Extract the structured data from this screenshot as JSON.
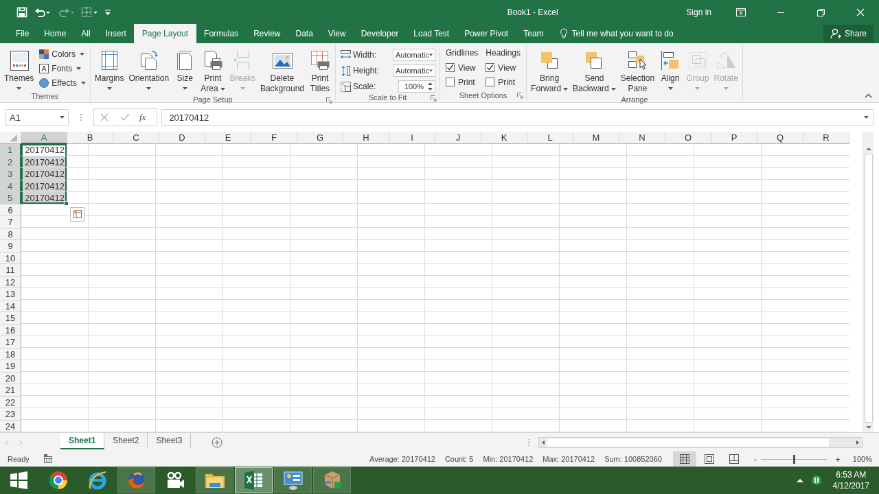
{
  "window": {
    "title": "Book1 - Excel",
    "sign_in": "Sign in"
  },
  "quick_access": [
    {
      "disabled": false
    },
    {
      "disabled": false
    },
    {
      "disabled": true
    },
    {
      "disabled": false
    },
    {
      "disabled": false
    }
  ],
  "tabs": [
    {
      "label": "File",
      "selected": false
    },
    {
      "label": "Home",
      "selected": false
    },
    {
      "label": "All",
      "selected": false
    },
    {
      "label": "Insert",
      "selected": false
    },
    {
      "label": "Page Layout",
      "selected": true
    },
    {
      "label": "Formulas",
      "selected": false
    },
    {
      "label": "Review",
      "selected": false
    },
    {
      "label": "Data",
      "selected": false
    },
    {
      "label": "View",
      "selected": false
    },
    {
      "label": "Developer",
      "selected": false
    },
    {
      "label": "Load Test",
      "selected": false
    },
    {
      "label": "Power Pivot",
      "selected": false
    },
    {
      "label": "Team",
      "selected": false
    }
  ],
  "tell_me": {
    "placeholder": "Tell me what you want to do"
  },
  "share": "Share",
  "ribbon": [
    {
      "label": "Themes",
      "launcher": false,
      "items": [
        {
          "kind": "large",
          "lines": [
            "Themes"
          ],
          "dropdown": true,
          "disabled": false
        },
        {
          "kind": "small",
          "label": "Colors",
          "dropdown": true,
          "disabled": false
        },
        {
          "kind": "small",
          "label": "Fonts",
          "dropdown": true,
          "disabled": false
        },
        {
          "kind": "small",
          "label": "Effects",
          "dropdown": true,
          "disabled": false
        }
      ]
    },
    {
      "label": "Page Setup",
      "launcher": true,
      "items": [
        {
          "kind": "large",
          "lines": [
            "Margins"
          ],
          "dropdown": true,
          "disabled": false
        },
        {
          "kind": "large",
          "lines": [
            "Orientation"
          ],
          "dropdown": true,
          "disabled": false
        },
        {
          "kind": "large",
          "lines": [
            "Size"
          ],
          "dropdown": true,
          "disabled": false
        },
        {
          "kind": "large",
          "lines": [
            "Print",
            "Area"
          ],
          "dropdown": true,
          "disabled": false
        },
        {
          "kind": "large",
          "lines": [
            "Breaks"
          ],
          "dropdown": true,
          "disabled": true
        },
        {
          "kind": "large",
          "lines": [
            "Delete",
            "Background"
          ],
          "dropdown": false,
          "disabled": false
        },
        {
          "kind": "large",
          "lines": [
            "Print",
            "Titles"
          ],
          "dropdown": false,
          "disabled": false
        }
      ]
    },
    {
      "label": "Scale to Fit",
      "launcher": true,
      "items": [
        {
          "kind": "dropdown",
          "label": "Width:",
          "value": "Automatic"
        },
        {
          "kind": "dropdown",
          "label": "Height:",
          "value": "Automatic"
        },
        {
          "kind": "spinner",
          "label": "Scale:",
          "value": "100%"
        }
      ]
    },
    {
      "label": "Sheet Options",
      "launcher": true,
      "items": [
        {
          "kind": "checks",
          "heading": "Gridlines",
          "boxes": [
            {
              "label": "View",
              "checked": true
            },
            {
              "label": "Print",
              "checked": false
            }
          ]
        },
        {
          "kind": "checks",
          "heading": "Headings",
          "boxes": [
            {
              "label": "View",
              "checked": true
            },
            {
              "label": "Print",
              "checked": false
            }
          ]
        }
      ]
    },
    {
      "label": "Arrange",
      "launcher": false,
      "items": [
        {
          "kind": "large",
          "lines": [
            "Bring",
            "Forward"
          ],
          "dropdown": true,
          "disabled": false
        },
        {
          "kind": "large",
          "lines": [
            "Send",
            "Backward"
          ],
          "dropdown": true,
          "disabled": false
        },
        {
          "kind": "large",
          "lines": [
            "Selection",
            "Pane"
          ],
          "dropdown": false,
          "disabled": false
        },
        {
          "kind": "large",
          "lines": [
            "Align"
          ],
          "dropdown": true,
          "disabled": false
        },
        {
          "kind": "large",
          "lines": [
            "Group"
          ],
          "dropdown": true,
          "disabled": true
        },
        {
          "kind": "large",
          "lines": [
            "Rotate"
          ],
          "dropdown": true,
          "disabled": true
        }
      ]
    }
  ],
  "formula_bar": {
    "name_box": "A1",
    "function_label": "fx",
    "value": "20170412"
  },
  "sheet": {
    "columns": [
      {
        "label": "A",
        "selected": true
      },
      {
        "label": "B",
        "selected": false
      },
      {
        "label": "C",
        "selected": false
      },
      {
        "label": "D",
        "selected": false
      },
      {
        "label": "E",
        "selected": false
      },
      {
        "label": "F",
        "selected": false
      },
      {
        "label": "G",
        "selected": false
      },
      {
        "label": "H",
        "selected": false
      },
      {
        "label": "I",
        "selected": false
      },
      {
        "label": "J",
        "selected": false
      },
      {
        "label": "K",
        "selected": false
      },
      {
        "label": "L",
        "selected": false
      },
      {
        "label": "M",
        "selected": false
      },
      {
        "label": "N",
        "selected": false
      },
      {
        "label": "O",
        "selected": false
      },
      {
        "label": "P",
        "selected": false
      },
      {
        "label": "Q",
        "selected": false
      },
      {
        "label": "R",
        "selected": false
      }
    ],
    "rows": [
      {
        "label": "1",
        "selected": true,
        "cells": [
          {
            "value": "20170412",
            "selected": true,
            "active": true
          }
        ]
      },
      {
        "label": "2",
        "selected": true,
        "cells": [
          {
            "value": "20170412",
            "selected": true,
            "active": false
          }
        ]
      },
      {
        "label": "3",
        "selected": true,
        "cells": [
          {
            "value": "20170412",
            "selected": true,
            "active": false
          }
        ]
      },
      {
        "label": "4",
        "selected": true,
        "cells": [
          {
            "value": "20170412",
            "selected": true,
            "active": false
          }
        ]
      },
      {
        "label": "5",
        "selected": true,
        "cells": [
          {
            "value": "20170412",
            "selected": true,
            "active": false
          }
        ]
      },
      {
        "label": "6",
        "selected": false
      },
      {
        "label": "7",
        "selected": false
      },
      {
        "label": "8",
        "selected": false
      },
      {
        "label": "9",
        "selected": false
      },
      {
        "label": "10",
        "selected": false
      },
      {
        "label": "11",
        "selected": false
      },
      {
        "label": "12",
        "selected": false
      },
      {
        "label": "13",
        "selected": false
      },
      {
        "label": "14",
        "selected": false
      },
      {
        "label": "15",
        "selected": false
      },
      {
        "label": "16",
        "selected": false
      },
      {
        "label": "17",
        "selected": false
      },
      {
        "label": "18",
        "selected": false
      },
      {
        "label": "19",
        "selected": false
      },
      {
        "label": "20",
        "selected": false
      },
      {
        "label": "21",
        "selected": false
      },
      {
        "label": "22",
        "selected": false
      },
      {
        "label": "23",
        "selected": false
      },
      {
        "label": "24",
        "selected": false
      }
    ]
  },
  "sheet_tabs": [
    {
      "label": "Sheet1",
      "selected": true
    },
    {
      "label": "Sheet2",
      "selected": false
    },
    {
      "label": "Sheet3",
      "selected": false
    }
  ],
  "status_bar": {
    "status": "Ready",
    "stats": [
      "Average: 20170412",
      "Count: 5",
      "Min: 20170412",
      "Max: 20170412",
      "Sum: 100852060"
    ],
    "views": [
      {
        "selected": true
      },
      {
        "selected": false
      },
      {
        "selected": false
      }
    ],
    "zoom": {
      "minus": "-",
      "plus": "+",
      "level": 0.5,
      "label": "100%"
    }
  },
  "taskbar": {
    "apps": [
      {
        "running": false,
        "selected": false
      },
      {
        "running": false,
        "selected": false
      },
      {
        "running": false,
        "selected": false
      },
      {
        "running": true,
        "selected": false
      },
      {
        "running": false,
        "selected": false
      },
      {
        "running": true,
        "selected": false
      },
      {
        "running": true,
        "selected": true
      },
      {
        "running": true,
        "selected": false
      },
      {
        "running": true,
        "selected": false
      }
    ],
    "time": "6:53 AM",
    "date": "4/12/2017"
  }
}
